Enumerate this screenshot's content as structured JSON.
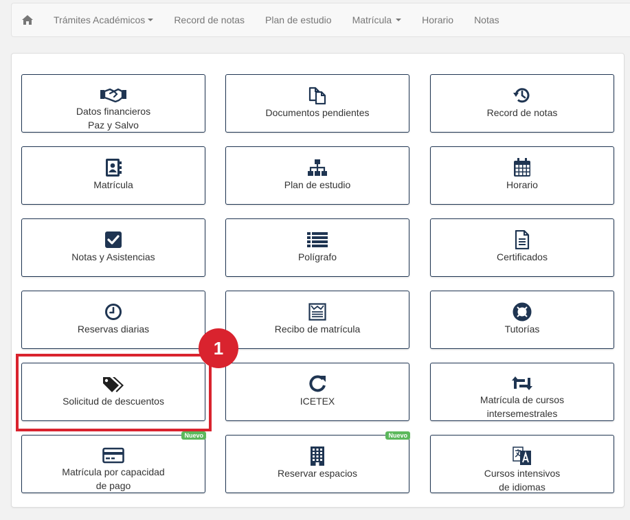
{
  "navbar": {
    "home_icon": "home-icon",
    "items": [
      {
        "label": "Trámites Académicos",
        "dropdown": true
      },
      {
        "label": "Record de notas",
        "dropdown": false
      },
      {
        "label": "Plan de estudio",
        "dropdown": false
      },
      {
        "label": "Matrícula",
        "dropdown": true
      },
      {
        "label": "Horario",
        "dropdown": false
      },
      {
        "label": "Notas",
        "dropdown": false
      }
    ]
  },
  "tiles": [
    {
      "line1": "Datos financieros",
      "line2": "Paz y Salvo",
      "icon": "handshake-icon"
    },
    {
      "line1": "Documentos pendientes",
      "line2": "",
      "icon": "documents-icon"
    },
    {
      "line1": "Record de notas",
      "line2": "",
      "icon": "history-icon"
    },
    {
      "line1": "Matrícula",
      "line2": "",
      "icon": "address-book-icon"
    },
    {
      "line1": "Plan de estudio",
      "line2": "",
      "icon": "sitemap-icon"
    },
    {
      "line1": "Horario",
      "line2": "",
      "icon": "calendar-icon"
    },
    {
      "line1": "Notas y Asistencias",
      "line2": "",
      "icon": "check-square-icon"
    },
    {
      "line1": "Polígrafo",
      "line2": "",
      "icon": "list-icon"
    },
    {
      "line1": "Certificados",
      "line2": "",
      "icon": "file-text-icon"
    },
    {
      "line1": "Reservas diarias",
      "line2": "",
      "icon": "clock-icon"
    },
    {
      "line1": "Recibo de matrícula",
      "line2": "",
      "icon": "newspaper-icon"
    },
    {
      "line1": "Tutorías",
      "line2": "",
      "icon": "life-ring-icon"
    },
    {
      "line1": "Solicitud de descuentos",
      "line2": "",
      "icon": "tags-icon"
    },
    {
      "line1": "ICETEX",
      "line2": "",
      "icon": "refresh-icon"
    },
    {
      "line1": "Matrícula de cursos",
      "line2": "intersemestrales",
      "icon": "retweet-icon"
    },
    {
      "line1": "Matrícula por capacidad",
      "line2": "de pago",
      "icon": "credit-card-icon",
      "badge": "Nuevo"
    },
    {
      "line1": "Reservar espacios",
      "line2": "",
      "icon": "building-icon",
      "badge": "Nuevo"
    },
    {
      "line1": "Cursos intensivos",
      "line2": "de idiomas",
      "icon": "language-icon"
    }
  ],
  "annotation": {
    "step": "1",
    "color": "#d9232e"
  },
  "colors": {
    "icon": "#1f3552",
    "border": "#1f3552",
    "badge": "#5cb85c"
  }
}
